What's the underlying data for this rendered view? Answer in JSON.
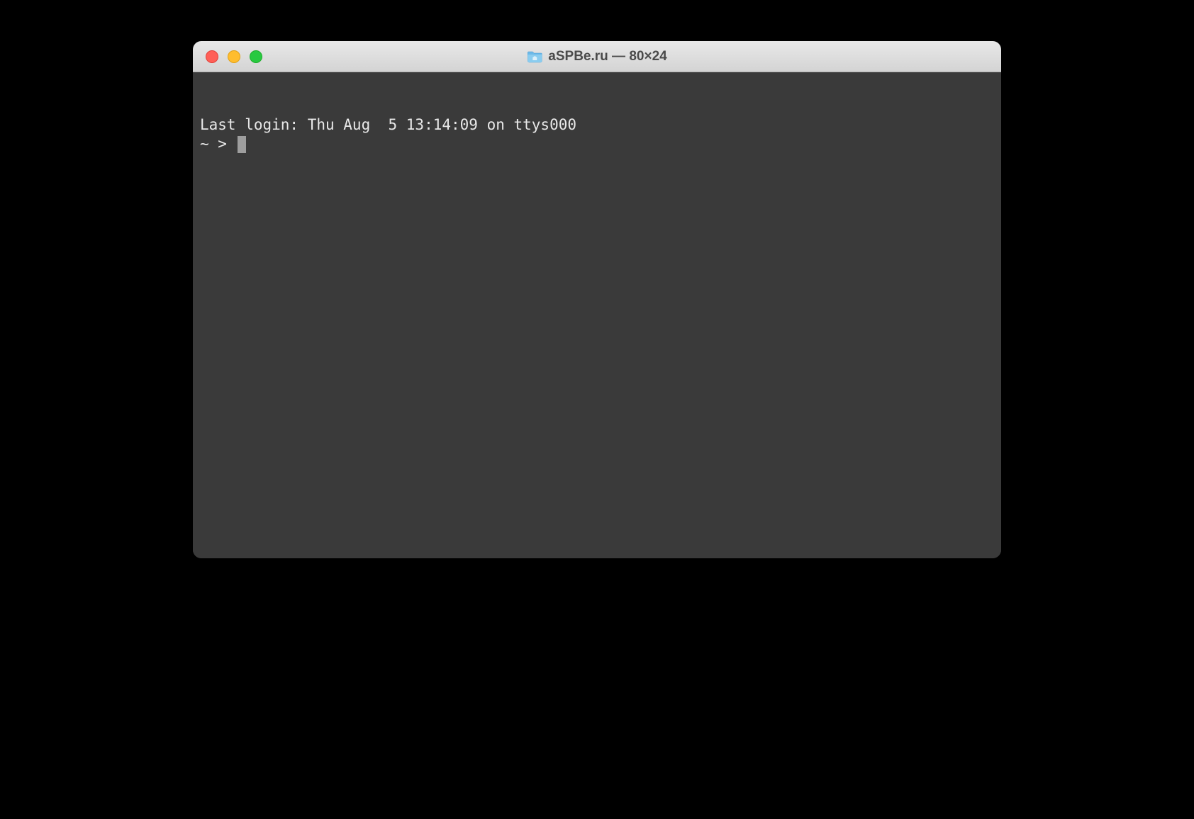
{
  "window": {
    "title": "aSPBe.ru — 80×24"
  },
  "terminal": {
    "last_login": "Last login: Thu Aug  5 13:14:09 on ttys000",
    "prompt": "~ > "
  }
}
